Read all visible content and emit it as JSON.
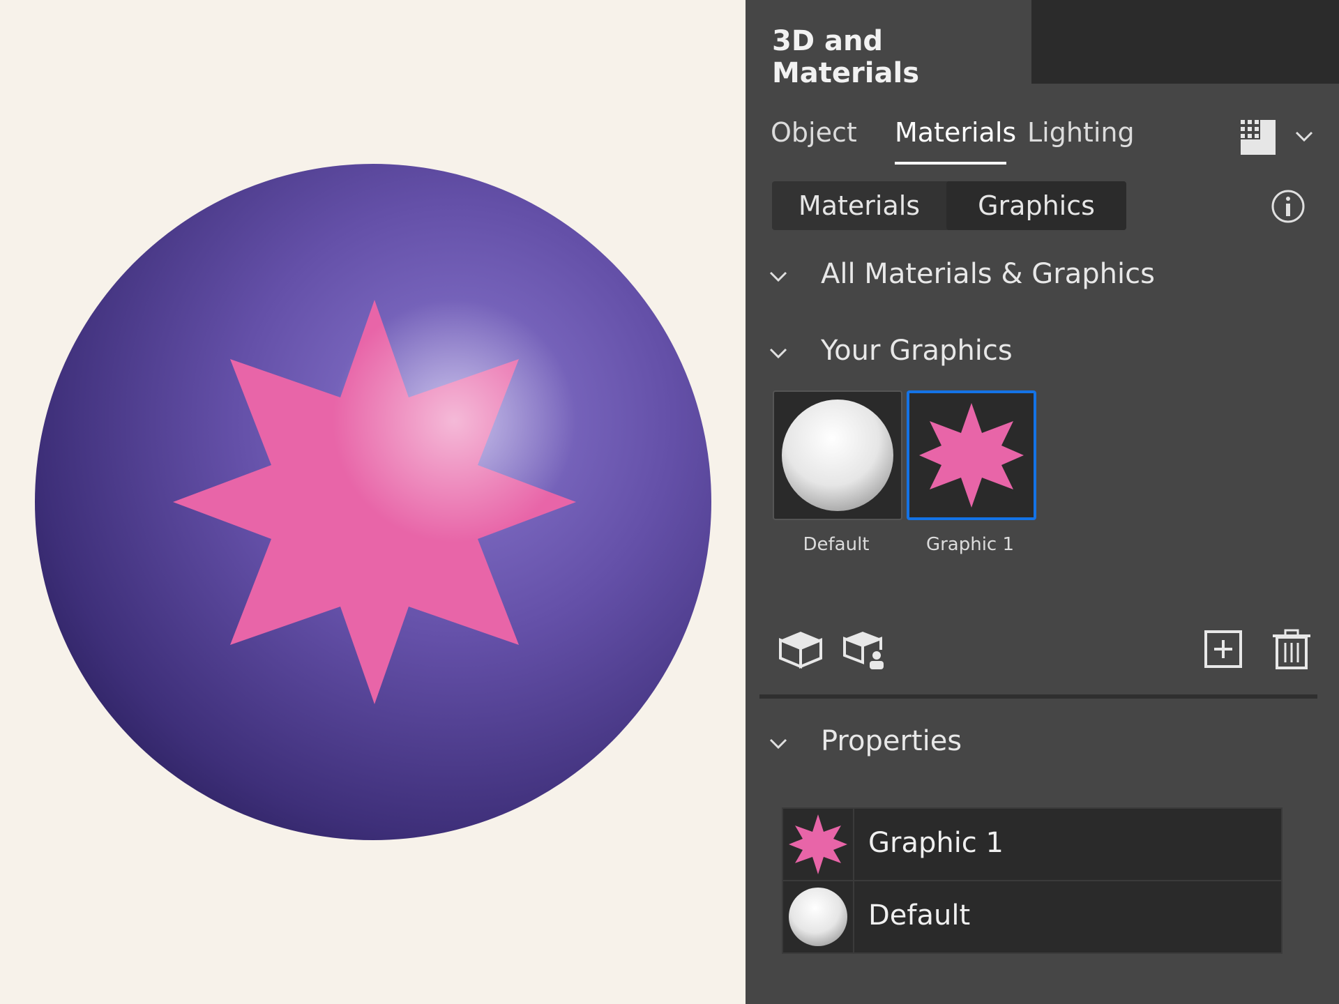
{
  "panel": {
    "title": "3D and Materials",
    "tabs": [
      {
        "label": "Object",
        "active": false
      },
      {
        "label": "Materials",
        "active": true
      },
      {
        "label": "Lighting",
        "active": false
      }
    ],
    "segments": [
      {
        "label": "Materials",
        "selected": false
      },
      {
        "label": "Graphics",
        "selected": true
      }
    ],
    "sections": {
      "all": "All Materials & Graphics",
      "yours": "Your Graphics",
      "properties": "Properties"
    },
    "thumbnails": [
      {
        "label": "Default",
        "icon": "sphere-icon"
      },
      {
        "label": "Graphic 1",
        "icon": "star-icon",
        "selected": true
      }
    ],
    "properties_list": [
      {
        "label": "Graphic 1",
        "icon": "star-icon"
      },
      {
        "label": "Default",
        "icon": "sphere-icon"
      }
    ]
  },
  "colors": {
    "accent": "#1473e6",
    "star": "#e865a8",
    "sphere": "#5b4a9e",
    "panel_bg": "#464646"
  }
}
